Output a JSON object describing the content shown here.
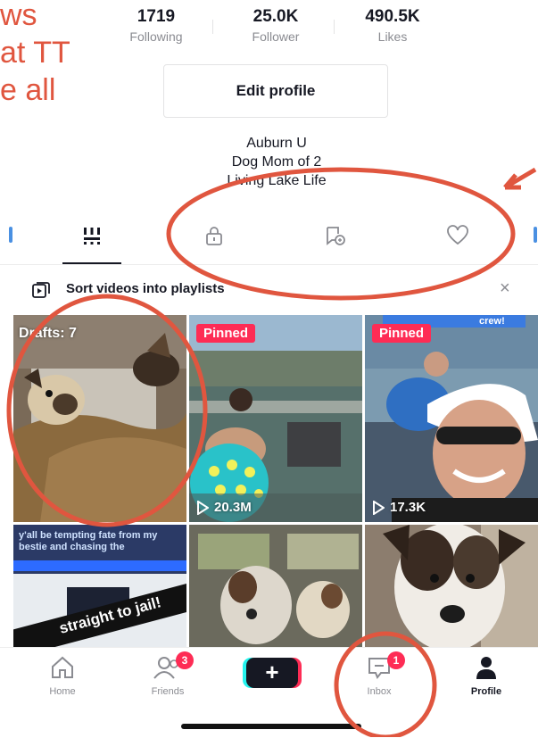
{
  "annotation": {
    "lines": [
      "ws",
      "at TT",
      "e all"
    ],
    "color": "#e0563f"
  },
  "stats": [
    {
      "value": "1719",
      "label": "Following"
    },
    {
      "value": "25.0K",
      "label": "Follower"
    },
    {
      "value": "490.5K",
      "label": "Likes"
    }
  ],
  "profile": {
    "edit_label": "Edit profile",
    "bio": [
      "Auburn U",
      "Dog Mom of 2",
      "Living Lake Life"
    ]
  },
  "tabs": {
    "icons": [
      "videos-grid-icon",
      "lock-icon",
      "repost-icon",
      "heart-icon"
    ],
    "active_index": 0
  },
  "playlist_banner": {
    "text": "Sort videos into playlists",
    "close": "×"
  },
  "grid": {
    "drafts_label": "Drafts: 7",
    "pinned_label": "Pinned",
    "views_2": "20.3M",
    "views_3": "17.3K",
    "cap_jail": "straight to jail!",
    "cap_lake_top": "crew!",
    "cap_cell4": "y'all be tempting fate from my bestie and chasing the"
  },
  "nav": {
    "home": "Home",
    "friends": "Friends",
    "friends_badge": "3",
    "plus": "+",
    "inbox": "Inbox",
    "inbox_badge": "1",
    "profile": "Profile"
  },
  "colors": {
    "accent": "#fe2c55",
    "annotation": "#e0563f",
    "text": "#161823",
    "muted": "#8a8b91"
  }
}
